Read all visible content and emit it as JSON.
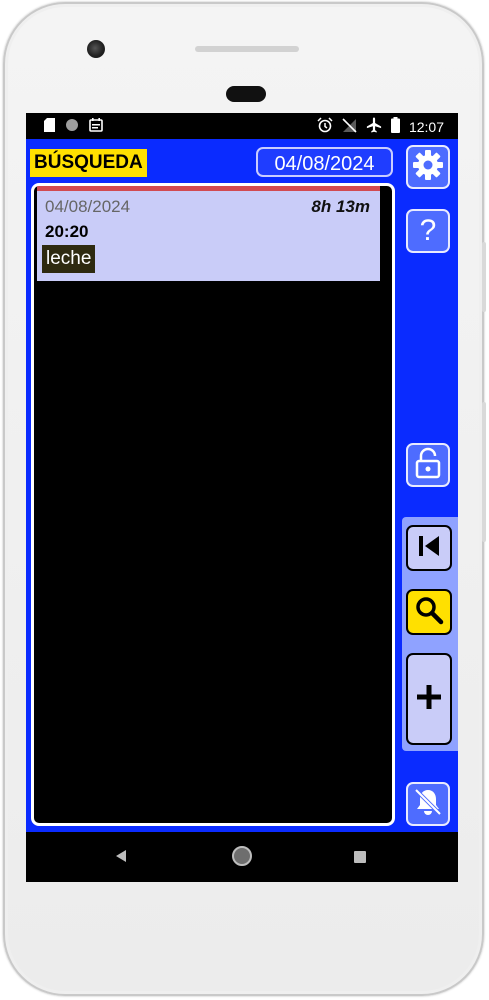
{
  "statusbar": {
    "left_icons": [
      "sd-card-icon",
      "circle-icon",
      "calendar-icon"
    ],
    "right_icons": [
      "alarm-icon",
      "no-signal-icon",
      "airplane-icon",
      "battery-icon"
    ],
    "time": "12:07"
  },
  "app": {
    "mode_label": "BÚSQUEDA",
    "date": "04/08/2024",
    "colors": {
      "background": "#0a2bff",
      "mode_badge": "#ffe000",
      "entry_bg": "#c9ccf8",
      "entry_accent": "#d14a52",
      "search_button": "#ffe000"
    },
    "entries": [
      {
        "date": "04/08/2024",
        "duration": "8h 13m",
        "time": "20:20",
        "tag": "leche"
      }
    ]
  },
  "sidebar": {
    "buttons": [
      "gear-icon",
      "help-icon",
      "unlock-icon"
    ],
    "help_label": "?",
    "nav_buttons": [
      "skip-start-icon",
      "search-icon",
      "plus-icon"
    ],
    "bottom_button": "bell-off-icon"
  },
  "navbar": [
    "back-icon",
    "home-icon",
    "recents-icon"
  ]
}
